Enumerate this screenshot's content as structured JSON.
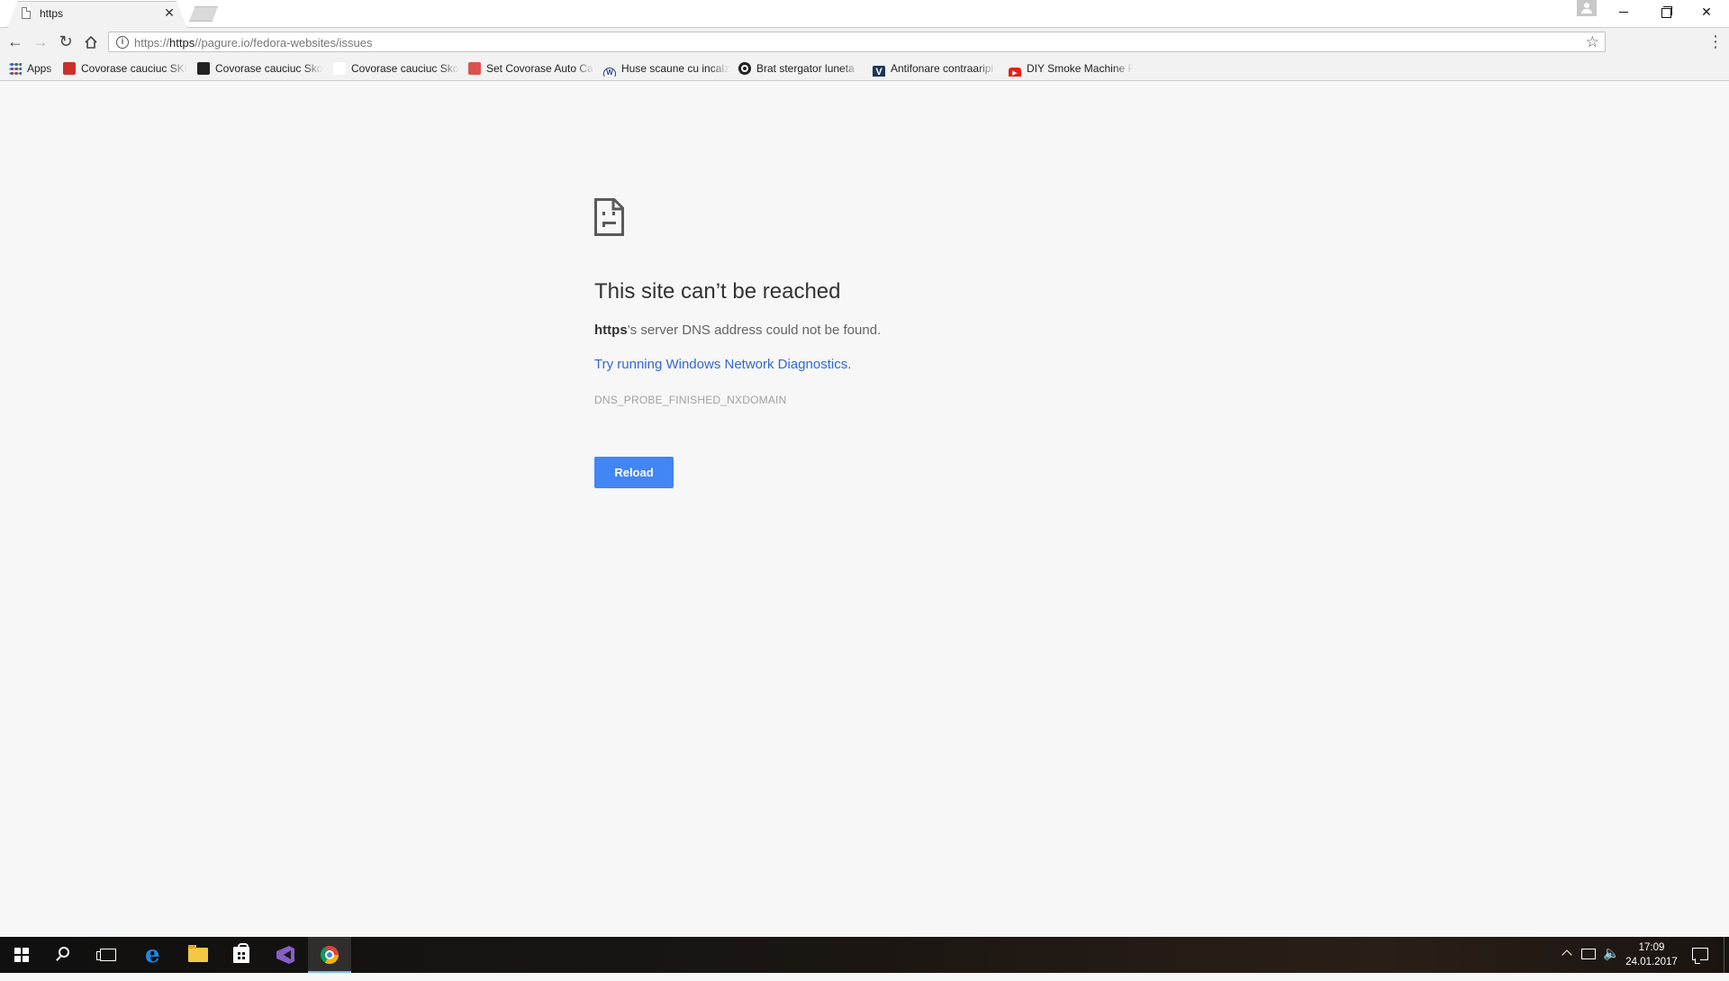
{
  "tab": {
    "title": "https"
  },
  "address_bar": {
    "url_scheme": "https://",
    "url_host": "https",
    "url_path": "//pagure.io/fedora-websites/issues"
  },
  "bookmarks": [
    {
      "label": "Apps",
      "icon": "apps-grid-icon"
    },
    {
      "label": "Covorase cauciuc SKODA",
      "icon": "site-favicon-red",
      "color": "#c9302c"
    },
    {
      "label": "Covorase cauciuc Skoda",
      "icon": "site-favicon-dark",
      "color": "#222222"
    },
    {
      "label": "Covorase cauciuc Skoda",
      "icon": "blank-favicon",
      "color": "#ffffff"
    },
    {
      "label": "Set Covorase Auto Ca",
      "icon": "site-favicon-red",
      "color": "#d9534f"
    },
    {
      "label": "Huse scaune cu incalzire",
      "icon": "vw-logo-icon",
      "color": "#1b3f8b"
    },
    {
      "label": "Brat stergator luneta",
      "icon": "circle-favicon",
      "color": "#222222"
    },
    {
      "label": "Antifonare contraaripi",
      "icon": "v-favicon",
      "color": "#1d3557"
    },
    {
      "label": "DIY Smoke Machine F",
      "icon": "youtube-icon",
      "color": "#e62117"
    }
  ],
  "error": {
    "title": "This site can’t be reached",
    "host": "https",
    "desc_suffix": "’s server DNS address could not be found.",
    "link": "Try running Windows Network Diagnostics.",
    "code": "DNS_PROBE_FINISHED_NXDOMAIN",
    "reload_label": "Reload"
  },
  "taskbar": {
    "apps": [
      "windows-start",
      "search",
      "task-view",
      "edge",
      "file-explorer",
      "store",
      "visual-studio",
      "chrome"
    ],
    "active": "chrome",
    "time": "17:09",
    "date": "24.01.2017"
  }
}
